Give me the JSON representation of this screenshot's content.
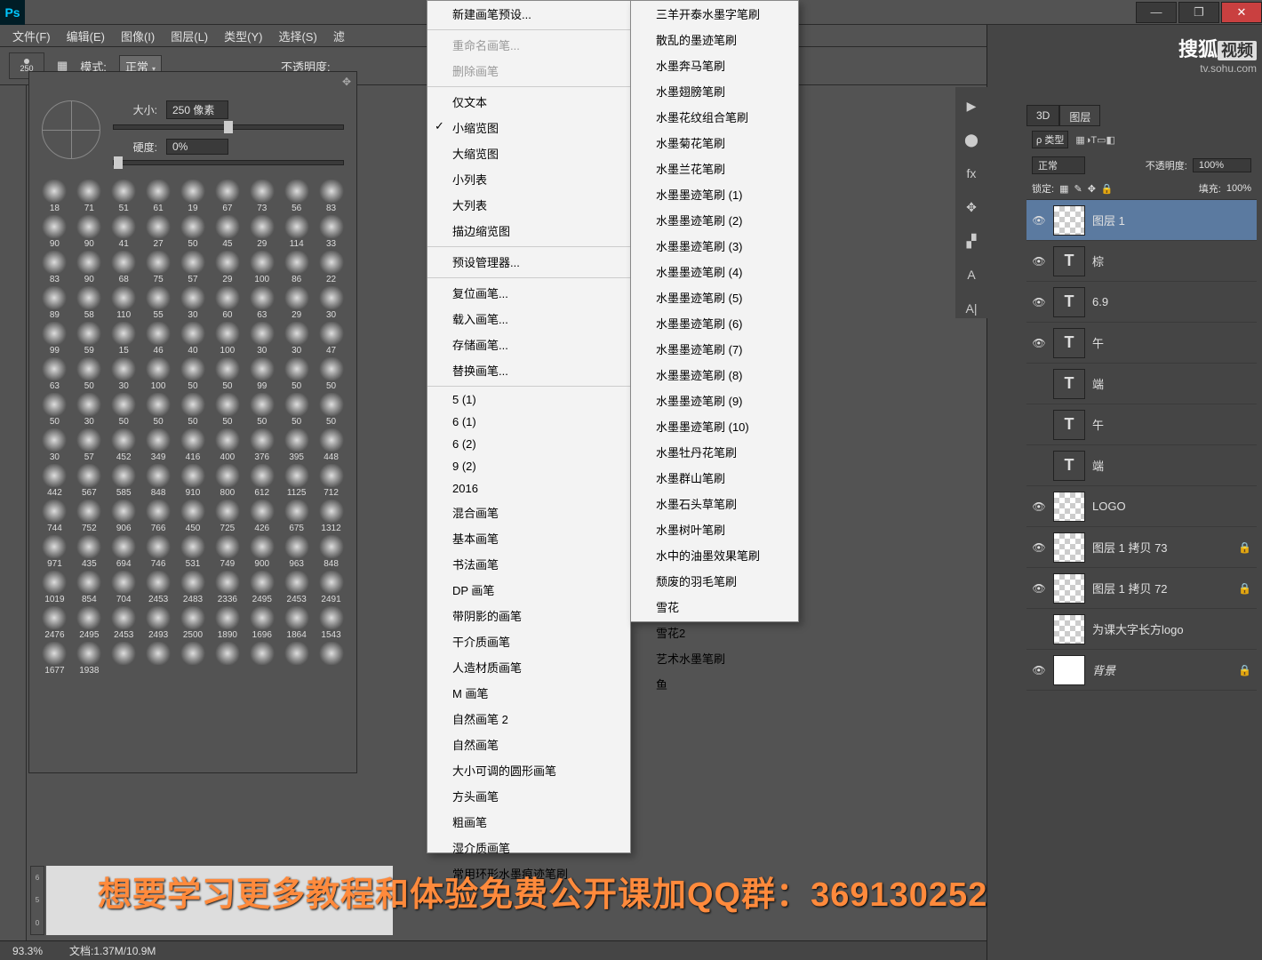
{
  "titlebar": {
    "logo": "Ps"
  },
  "win_controls": {
    "min": "—",
    "max": "❐",
    "close": "✕"
  },
  "menubar": [
    "文件(F)",
    "编辑(E)",
    "图像(I)",
    "图层(L)",
    "类型(Y)",
    "选择(S)",
    "滤"
  ],
  "optbar": {
    "size": "250",
    "mode_label": "模式:",
    "mode_value": "正常",
    "opacity_label": "不透明度:"
  },
  "brush_panel": {
    "gear": "✥",
    "size_label": "大小:",
    "size_value": "250 像素",
    "hardness_label": "硬度:",
    "hardness_value": "0%",
    "thumb_labels": [
      "18",
      "71",
      "51",
      "61",
      "19",
      "67",
      "73",
      "56",
      "83",
      "90",
      "90",
      "41",
      "27",
      "50",
      "45",
      "29",
      "114",
      "33",
      "83",
      "90",
      "68",
      "75",
      "57",
      "29",
      "100",
      "86",
      "22",
      "89",
      "58",
      "110",
      "55",
      "30",
      "60",
      "63",
      "29",
      "30",
      "99",
      "59",
      "15",
      "46",
      "40",
      "100",
      "30",
      "30",
      "47",
      "63",
      "50",
      "30",
      "100",
      "50",
      "50",
      "99",
      "50",
      "50",
      "50",
      "30",
      "50",
      "50",
      "50",
      "50",
      "50",
      "50",
      "50",
      "30",
      "57",
      "452",
      "349",
      "416",
      "400",
      "376",
      "395",
      "448",
      "442",
      "567",
      "585",
      "848",
      "910",
      "800",
      "612",
      "1125",
      "712",
      "744",
      "752",
      "906",
      "766",
      "450",
      "725",
      "426",
      "675",
      "1312",
      "971",
      "435",
      "694",
      "746",
      "531",
      "749",
      "900",
      "963",
      "848",
      "1019",
      "854",
      "704",
      "2453",
      "2483",
      "2336",
      "2495",
      "2453",
      "2491",
      "2476",
      "2495",
      "2453",
      "2493",
      "2500",
      "1890",
      "1696",
      "1864",
      "1543",
      "1677",
      "1938",
      "",
      "",
      "",
      "",
      "",
      "",
      ""
    ]
  },
  "menu_left": [
    {
      "t": "新建画笔预设..."
    },
    {
      "t": "重命名画笔...",
      "sep": true,
      "dis": true
    },
    {
      "t": "删除画笔",
      "dis": true
    },
    {
      "t": "仅文本",
      "sep": true
    },
    {
      "t": "小缩览图",
      "check": true
    },
    {
      "t": "大缩览图"
    },
    {
      "t": "小列表"
    },
    {
      "t": "大列表"
    },
    {
      "t": "描边缩览图"
    },
    {
      "t": "预设管理器...",
      "sep": true
    },
    {
      "t": "复位画笔...",
      "sep": true
    },
    {
      "t": "载入画笔..."
    },
    {
      "t": "存储画笔..."
    },
    {
      "t": "替换画笔..."
    },
    {
      "t": "5 (1)",
      "sep": true
    },
    {
      "t": "6 (1)"
    },
    {
      "t": "6 (2)"
    },
    {
      "t": "9 (2)"
    },
    {
      "t": "2016"
    },
    {
      "t": "混合画笔"
    },
    {
      "t": "基本画笔"
    },
    {
      "t": "书法画笔"
    },
    {
      "t": "DP 画笔"
    },
    {
      "t": "带阴影的画笔"
    },
    {
      "t": "干介质画笔"
    },
    {
      "t": "人造材质画笔"
    },
    {
      "t": "M 画笔"
    },
    {
      "t": "自然画笔 2"
    },
    {
      "t": "自然画笔"
    },
    {
      "t": "大小可调的圆形画笔"
    },
    {
      "t": "方头画笔"
    },
    {
      "t": "粗画笔"
    },
    {
      "t": "湿介质画笔"
    },
    {
      "t": "常用环形水墨痕迹笔刷"
    }
  ],
  "menu_right": [
    {
      "t": "三羊开泰水墨字笔刷"
    },
    {
      "t": "散乱的墨迹笔刷"
    },
    {
      "t": "水墨奔马笔刷"
    },
    {
      "t": "水墨翅膀笔刷"
    },
    {
      "t": "水墨花纹组合笔刷"
    },
    {
      "t": "水墨菊花笔刷"
    },
    {
      "t": "水墨兰花笔刷"
    },
    {
      "t": "水墨墨迹笔刷 (1)"
    },
    {
      "t": "水墨墨迹笔刷 (2)"
    },
    {
      "t": "水墨墨迹笔刷 (3)"
    },
    {
      "t": "水墨墨迹笔刷 (4)"
    },
    {
      "t": "水墨墨迹笔刷 (5)"
    },
    {
      "t": "水墨墨迹笔刷 (6)"
    },
    {
      "t": "水墨墨迹笔刷 (7)"
    },
    {
      "t": "水墨墨迹笔刷 (8)"
    },
    {
      "t": "水墨墨迹笔刷 (9)"
    },
    {
      "t": "水墨墨迹笔刷 (10)"
    },
    {
      "t": "水墨牡丹花笔刷"
    },
    {
      "t": "水墨群山笔刷"
    },
    {
      "t": "水墨石头草笔刷"
    },
    {
      "t": "水墨树叶笔刷"
    },
    {
      "t": "水中的油墨效果笔刷"
    },
    {
      "t": "颓废的羽毛笔刷"
    },
    {
      "t": "雪花"
    },
    {
      "t": "雪花2"
    },
    {
      "t": "艺术水墨笔刷"
    },
    {
      "t": "鱼"
    }
  ],
  "brand": {
    "a": "搜狐",
    "b": "视频",
    "url": "tv.sohu.com"
  },
  "layers_panel": {
    "tabs": [
      "3D",
      "图层"
    ],
    "filter_label": "ρ 类型",
    "mode": "正常",
    "opacity_label": "不透明度:",
    "opacity_value": "100%",
    "lock_label": "锁定:",
    "fill_label": "填充:",
    "fill_value": "100%",
    "filter_icons": [
      "▦",
      "◑",
      "T",
      "▭",
      "◧"
    ]
  },
  "layers": [
    {
      "eye": "👁",
      "thumb": "chk",
      "name": "图层 1",
      "sel": true
    },
    {
      "eye": "👁",
      "thumb": "t",
      "tt": "T",
      "name": "棕"
    },
    {
      "eye": "👁",
      "thumb": "t",
      "tt": "T",
      "name": "6.9"
    },
    {
      "eye": "👁",
      "thumb": "t",
      "tt": "T",
      "name": "午"
    },
    {
      "eye": "",
      "thumb": "t",
      "tt": "T",
      "name": "端"
    },
    {
      "eye": "",
      "thumb": "t",
      "tt": "T",
      "name": "午"
    },
    {
      "eye": "",
      "thumb": "t",
      "tt": "T",
      "name": "端"
    },
    {
      "eye": "👁",
      "thumb": "chk",
      "name": "LOGO"
    },
    {
      "eye": "👁",
      "thumb": "chk",
      "name": "图层 1 拷贝 73",
      "lock": true
    },
    {
      "eye": "👁",
      "thumb": "chk",
      "name": "图层 1 拷贝 72",
      "lock": true
    },
    {
      "eye": "",
      "thumb": "chk",
      "name": "为课大字长方logo"
    },
    {
      "eye": "👁",
      "thumb": "w",
      "name": "背景",
      "italic": true,
      "lock": true
    }
  ],
  "status": {
    "zoom": "93.3%",
    "doc": "文档:1.37M/10.9M"
  },
  "iconstrip": [
    "▶",
    "⬤",
    "fx",
    "✥",
    "▞",
    "A",
    "A|"
  ],
  "overlay": "想要学习更多教程和体验免费公开课加QQ群：369130252",
  "ruler": [
    "6",
    "5",
    "0"
  ]
}
